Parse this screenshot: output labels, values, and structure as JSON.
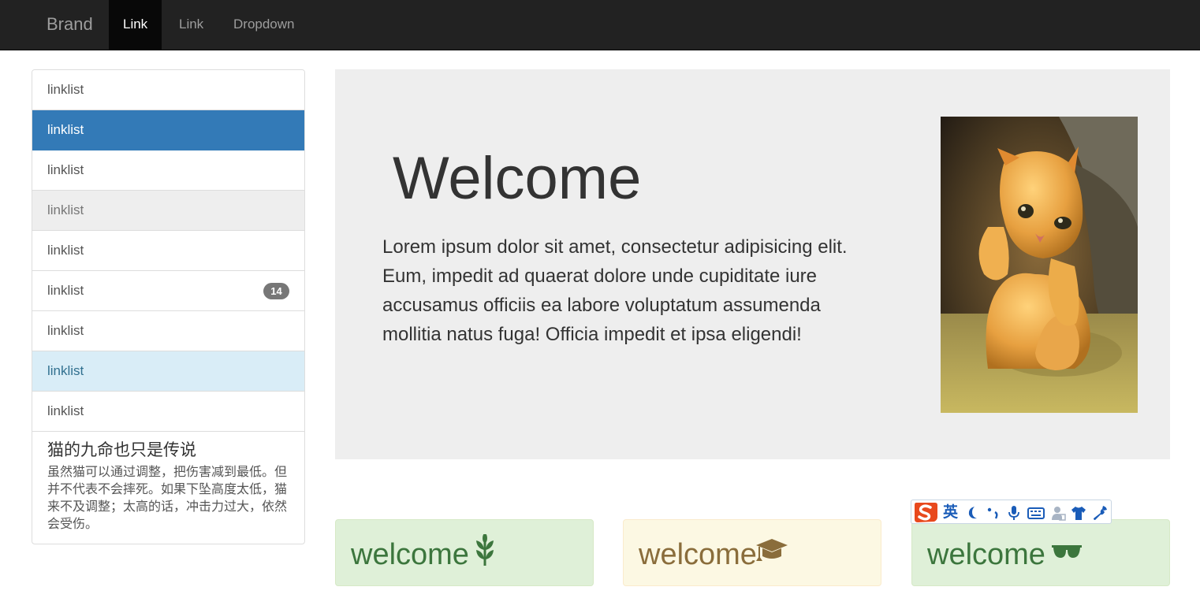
{
  "navbar": {
    "brand": "Brand",
    "items": [
      {
        "label": "Link",
        "active": true
      },
      {
        "label": "Link",
        "active": false
      },
      {
        "label": "Dropdown",
        "active": false
      }
    ]
  },
  "sidebar": {
    "items": [
      {
        "label": "linklist",
        "state": "default"
      },
      {
        "label": "linklist",
        "state": "active"
      },
      {
        "label": "linklist",
        "state": "default"
      },
      {
        "label": "linklist",
        "state": "disabled"
      },
      {
        "label": "linklist",
        "state": "default"
      },
      {
        "label": "linklist",
        "state": "default",
        "badge": "14"
      },
      {
        "label": "linklist",
        "state": "default"
      },
      {
        "label": "linklist",
        "state": "info"
      },
      {
        "label": "linklist",
        "state": "default"
      }
    ],
    "article": {
      "heading": "猫的九命也只是传说",
      "text": "虽然猫可以通过调整，把伤害减到最低。但并不代表不会摔死。如果下坠高度太低，猫来不及调整；太高的话，冲击力过大，依然会受伤。"
    }
  },
  "jumbotron": {
    "title": "Welcome",
    "text": "Lorem ipsum dolor sit amet, consectetur adipisicing elit. Eum, impedit ad quaerat dolore unde cupiditate iure accusamus officiis ea labore voluptatum assumenda mollitia natus fuga! Officia impedit et ipsa eligendi!",
    "photo_icon": "kitten-photo"
  },
  "alerts": [
    {
      "text": "welcome",
      "style": "success",
      "icon": "grain-icon"
    },
    {
      "text": "welcome",
      "style": "warning",
      "icon": "education-icon"
    },
    {
      "text": "welcome",
      "style": "success",
      "icon": "sunglasses-icon"
    }
  ],
  "ime_toolbar": {
    "lang": "英",
    "tools": [
      "moon-icon",
      "punctuation-icon",
      "microphone-icon",
      "keyboard-icon",
      "user-icon",
      "skin-shirt-icon",
      "settings-wrench-icon"
    ]
  },
  "colors": {
    "navbar_bg": "#222222",
    "active_blue": "#337ab7",
    "info_bg": "#d9edf7",
    "success_bg": "#dff0d8",
    "warning_bg": "#fcf8e3",
    "jumbotron_bg": "#eeeeee"
  }
}
